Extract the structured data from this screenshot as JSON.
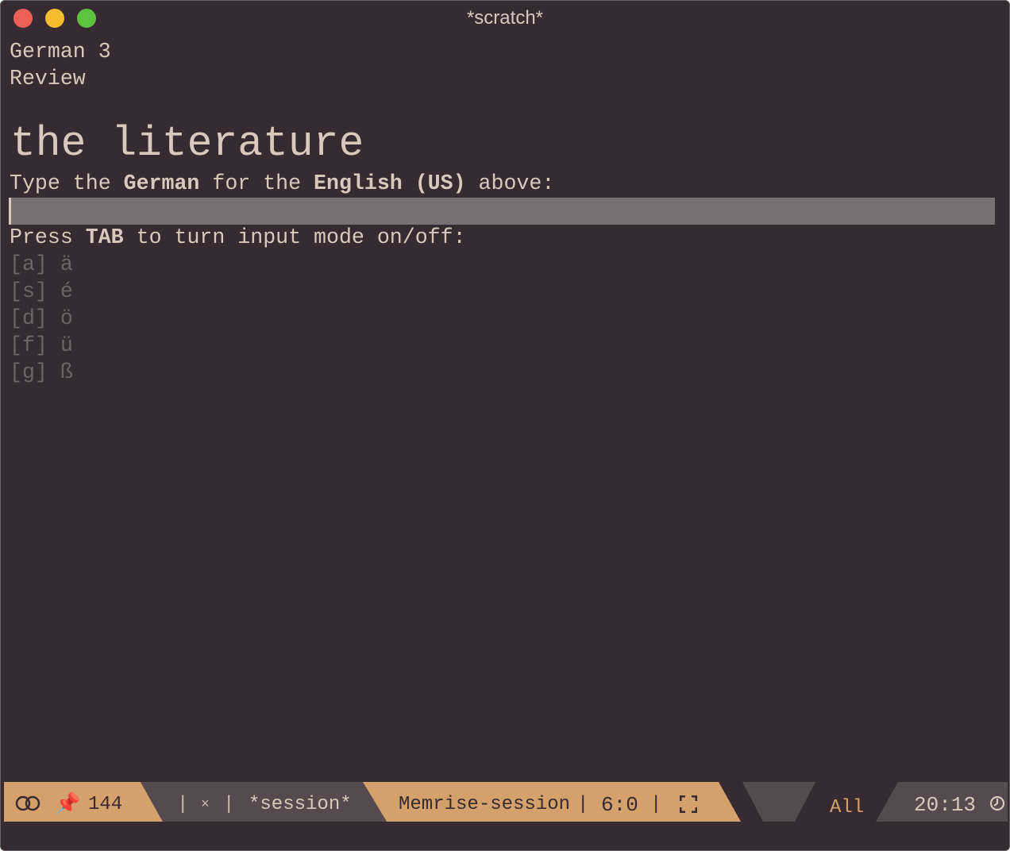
{
  "window": {
    "title": "*scratch*"
  },
  "buffer": {
    "course": "German 3",
    "mode": "Review",
    "prompt_word": "the literature",
    "instruction": {
      "p1": "Type the ",
      "b1": "German",
      "p2": " for the ",
      "b2": "English (US)",
      "p3": " above:"
    },
    "answer_value": "",
    "tab_hint": {
      "p1": "Press ",
      "b1": "TAB",
      "p2": " to turn input mode on/off:"
    },
    "shortcuts": [
      {
        "key": "[a]",
        "char": "ä"
      },
      {
        "key": "[s]",
        "char": "é"
      },
      {
        "key": "[d]",
        "char": "ö"
      },
      {
        "key": "[f]",
        "char": "ü"
      },
      {
        "key": "[g]",
        "char": "ß"
      }
    ]
  },
  "modeline": {
    "line_count": "144",
    "sep1": "|",
    "close": "×",
    "sep2": "|",
    "session": "*session*",
    "major_mode": "Memrise-session",
    "sep3": "|",
    "position": "6:0",
    "sep4": "|",
    "scroll": "All",
    "time": "20:13"
  },
  "colors": {
    "bg": "#372b31",
    "fg": "#d8c8bd",
    "accent": "#d4a06c",
    "dim": "#6f6367"
  }
}
